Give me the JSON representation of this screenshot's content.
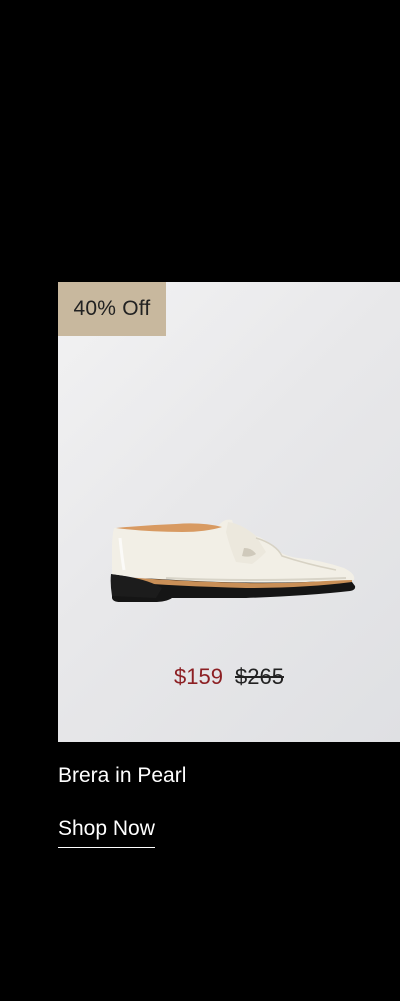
{
  "product": {
    "badge": "40% Off",
    "image_alt": "Brera in Pearl loafer",
    "sale_price": "$159",
    "original_price": "$265",
    "name": "Brera in Pearl",
    "cta_label": "Shop Now"
  },
  "colors": {
    "page_background": "#000000",
    "badge_background": "#c8b89e",
    "sale_price": "#8c1f23",
    "card_background": "#e8e8ea"
  }
}
